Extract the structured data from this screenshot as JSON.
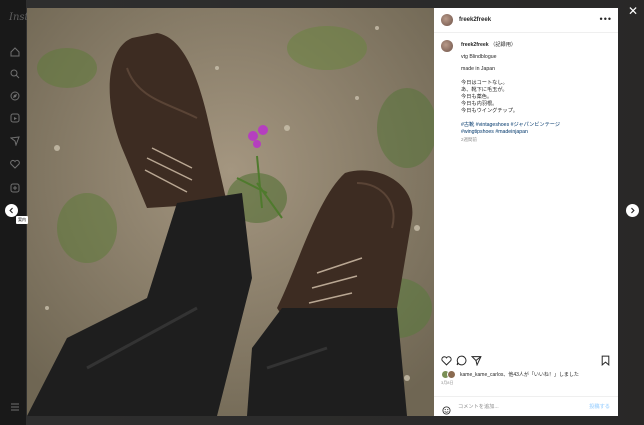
{
  "app": {
    "logo": "Inst"
  },
  "post": {
    "username": "freek2freek",
    "caption_user": "freek2freek",
    "caption_note": "（記録用）",
    "caption_lines": [
      "vtg Blindblogue",
      "made in Japan",
      "",
      "今日はコートなし。",
      "あ、靴下に毛玉が。",
      "今日も薬色。",
      "今日も内羽根。",
      "今日もウイングチップ。"
    ],
    "hashtags": [
      "#古靴 #vintageshoes #ジャパンビンテージ",
      "#wingtipshoes #madeinjapan"
    ],
    "age": "2週間前",
    "likes_text": "kame_kame_carlos、他43人が「いいね！」しました",
    "date": "3月8日",
    "comment_placeholder": "コメントを追加...",
    "post_button": "投稿する"
  },
  "tooltip": "案内",
  "icons": {
    "sidebar": [
      "home-icon",
      "search-icon",
      "explore-icon",
      "reels-icon",
      "messages-icon",
      "notifications-icon",
      "create-icon",
      "menu-icon"
    ],
    "actions": [
      "heart-icon",
      "comment-icon",
      "share-icon",
      "bookmark-icon"
    ]
  },
  "colors": {
    "link": "#00376b",
    "muted": "#8e8e8e",
    "post_disabled": "#b3dbff"
  }
}
